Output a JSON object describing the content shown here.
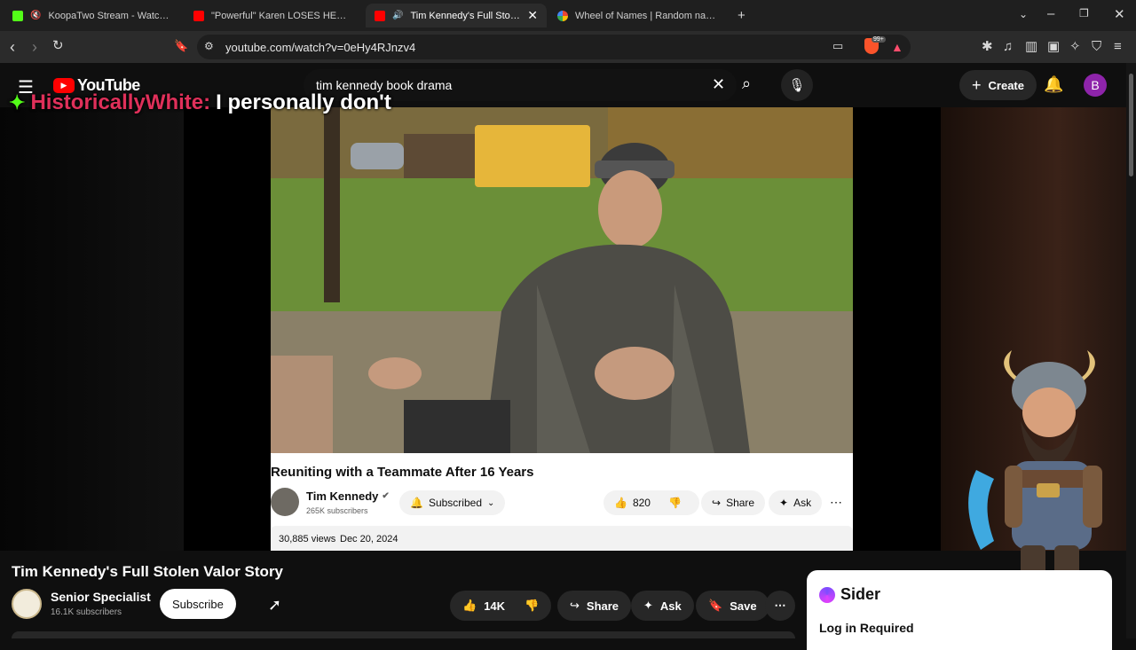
{
  "browser": {
    "tabs": [
      {
        "title": "KoopaTwo Stream - Watch Live o",
        "favicon_color": "#53fc18",
        "muted": true
      },
      {
        "title": "\"Powerful\" Karen LOSES HER MIND W",
        "favicon_color": "#ff0000",
        "muted": false
      },
      {
        "title": "Tim Kennedy's Full Stolen Valo",
        "favicon_color": "#ff0000",
        "muted": false,
        "active": true
      },
      {
        "title": "Wheel of Names | Random name pic",
        "favicon_color": "#4285f4",
        "muted": false
      }
    ],
    "url": "youtube.com/watch?v=0eHy4RJnzv4",
    "brave_badge": "99+"
  },
  "youtube": {
    "logo_text": "YouTube",
    "search_value": "tim kennedy book drama",
    "create_label": "Create",
    "avatar_letter": "B"
  },
  "chat_overlay": {
    "username": "HistoricallyWhite:",
    "message": "I personally don't"
  },
  "inner_video": {
    "title": "Reuniting with a Teammate After 16 Years",
    "channel": "Tim Kennedy",
    "subscribers": "265K subscribers",
    "subscribed_label": "Subscribed",
    "likes": "820",
    "share_label": "Share",
    "ask_label": "Ask",
    "views": "30,885 views",
    "date": "Dec 20, 2024"
  },
  "page": {
    "video_title": "Tim Kennedy's Full Stolen Valor Story",
    "channel_name": "Senior Specialist",
    "channel_subscribers": "16.1K subscribers",
    "subscribe_label": "Subscribe",
    "likes": "14K",
    "share_label": "Share",
    "ask_label": "Ask",
    "save_label": "Save"
  },
  "sider": {
    "brand": "Sider",
    "status": "Log in Required"
  },
  "colors": {
    "youtube_red": "#ff0000",
    "chat_name": "#e0305a",
    "avatar_bg": "#8e24aa",
    "sider_accent": "#7c4dff"
  }
}
